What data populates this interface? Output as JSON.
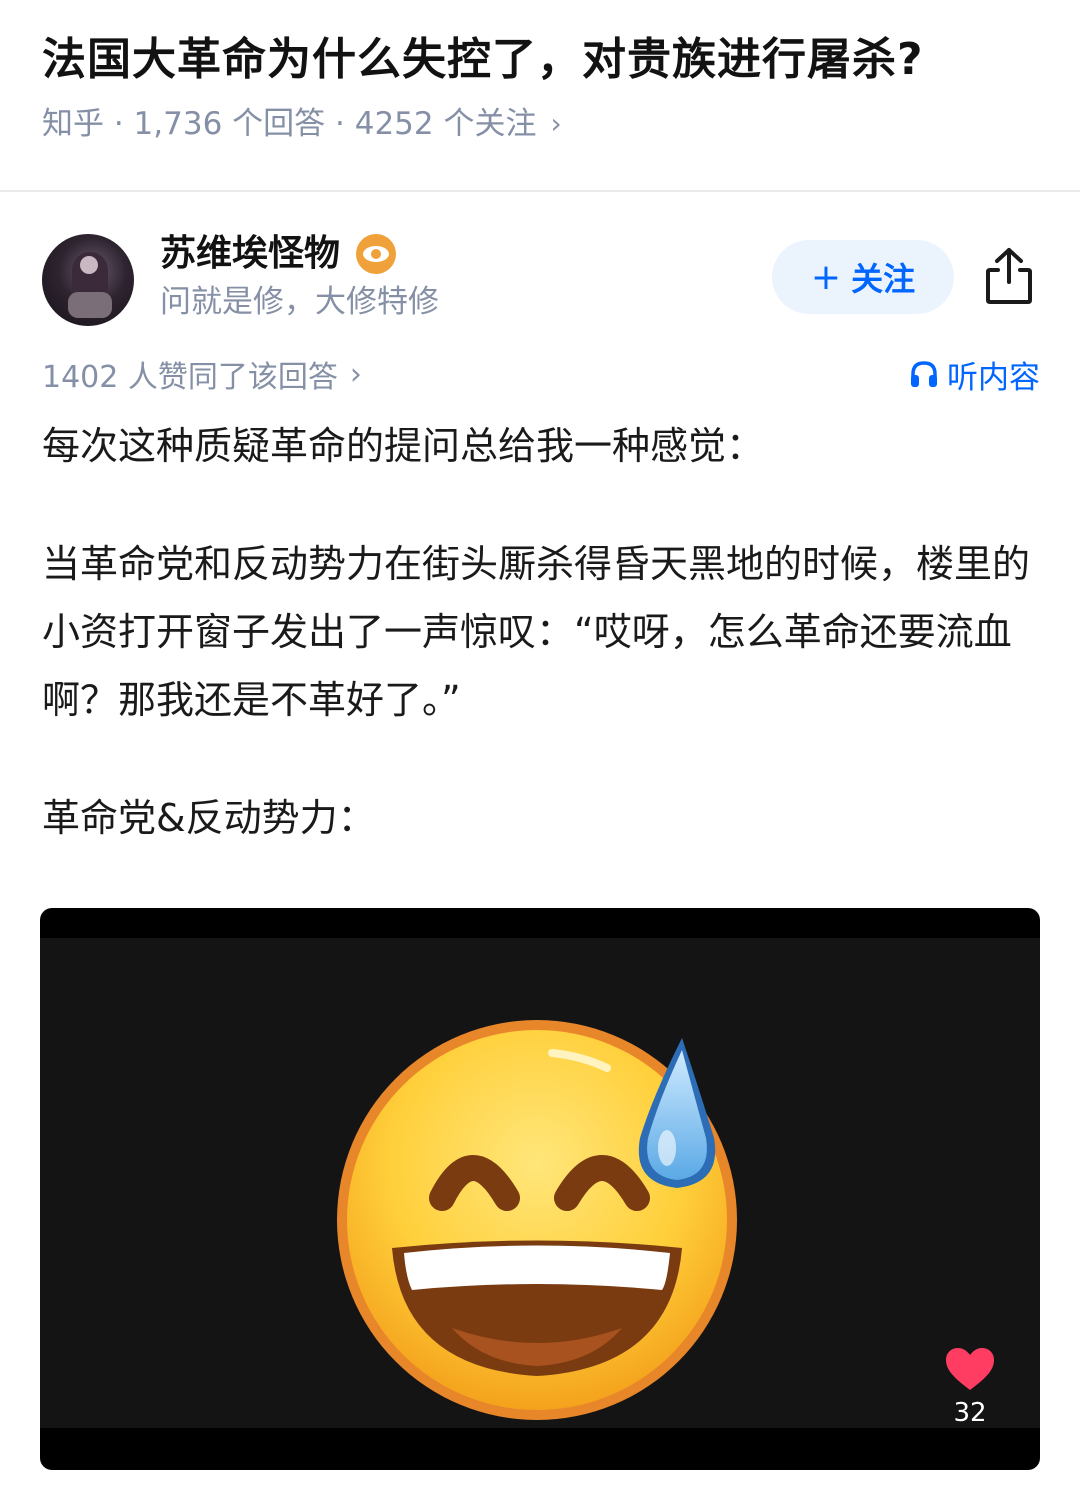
{
  "question": {
    "title": "法国大革命为什么失控了，对贵族进行屠杀?",
    "meta": "知乎 · 1,736 个回答 · 4252 个关注",
    "meta_chevron": "›"
  },
  "author": {
    "name": "苏维埃怪物",
    "bio": "问就是修，大修特修",
    "follow_label": "关注",
    "follow_plus": "+"
  },
  "vote": {
    "text": "1402 人赞同了该回答",
    "chevron": "›"
  },
  "listen": {
    "label": "听内容"
  },
  "content": {
    "p1": "每次这种质疑革命的提问总给我一种感觉：",
    "p2": "当革命党和反动势力在街头厮杀得昏天黑地的时候，楼里的小资打开窗子发出了一声惊叹：“哎呀，怎么革命还要流血啊？那我还是不革好了。”",
    "p3": "革命党&反动势力："
  },
  "image": {
    "likes": "32",
    "icon": "grinning-sweat-emoji"
  },
  "colors": {
    "accent": "#0066ff",
    "meta": "#8590a6",
    "follow_bg": "#ebf4fd",
    "heart": "#ff3d62"
  }
}
